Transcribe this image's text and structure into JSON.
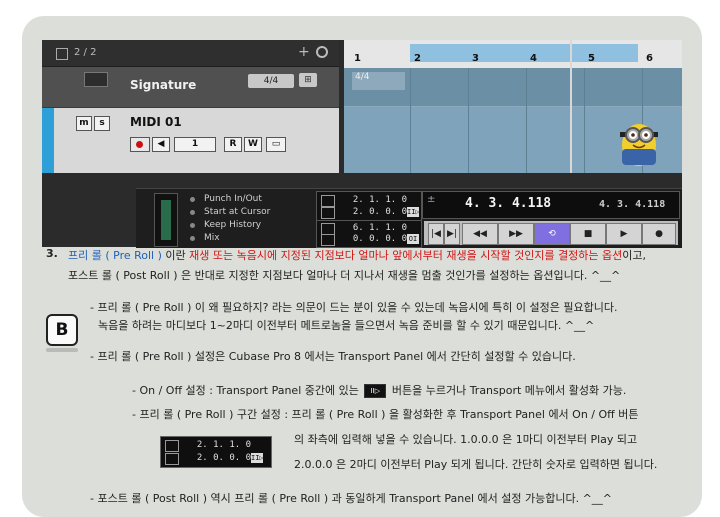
{
  "daw": {
    "track_count": "2 / 2",
    "signature_track_name": "Signature",
    "signature_value": "4/4",
    "midi_track_name": "MIDI 01",
    "midi_buttons": {
      "mute": "m",
      "solo": "s",
      "channel": "1",
      "read": "R",
      "write": "W"
    },
    "ruler_numbers": [
      "1",
      "2",
      "3",
      "4",
      "5",
      "6"
    ],
    "signature_marker": "4/4",
    "transport": {
      "options": [
        "Punch In/Out",
        "Start at Cursor",
        "Keep History",
        "Mix"
      ],
      "preroll_value": "2. 1. 1.  0",
      "postroll_value": "2. 0. 0.  0",
      "cycle_start": "6. 1. 1.  0",
      "cycle_end": "0. 0. 0.  0",
      "position_main": "4.  3.  4.118",
      "position_secondary": "4. 3. 4.118",
      "plusminus": "+\n−"
    }
  },
  "content": {
    "item_number": "3.",
    "line1_a": "프리 롤 ( Pre Roll )",
    "line1_b": " 이란 ",
    "line1_red": "재생 또는 녹음시에 지정된 지점보다 얼마나 앞에서부터 재생을 시작할 것인지를 결정하는 옵션",
    "line1_c": "이고,",
    "line2": "포스트 롤 ( Post Roll ) 은 반대로 지정한 지점보다 얼마나 더 지나서 재생을 멈출 것인가를 설정하는 옵션입니다. ^__^",
    "badge": "B",
    "bullet1_a": "- 프리 롤 ( Pre Roll ) 이 왜 필요하지? 라는 의문이 드는 분이 있을 수 있는데 녹음시에 특히 이 설정은 필요합니다.",
    "bullet1_b": "녹음을 하려는 마디보다 1~2마디 이전부터 메트로놈을 들으면서 녹음 준비를 할 수 있기 때문입니다. ^__^",
    "bullet2": "- 프리 롤 ( Pre Roll ) 설정은 Cubase Pro 8 에서는 Transport Panel 에서 간단히 설정할 수 있습니다.",
    "sub1_a": "- On / Off  설정 : Transport Panel 중간에 있는",
    "sub1_b": "버튼을 누르거나 Transport 메뉴에서 활성화 가능.",
    "sub2": "- 프리 롤 ( Pre Roll ) 구간 설정 : 프리 롤 ( Pre Roll ) 을 활성화한 후 Transport Panel 에서 On / Off 버튼",
    "sub2_c1": "의 좌측에 입력해 넣을 수 있습니다. 1.0.0.0 은 1마디 이전부터 Play 되고",
    "sub2_c2": "2.0.0.0 은 2마디 이전부터 Play 되게 됩니다. 간단히 숫자로 입력하면 됩니다.",
    "mini_pre": "2.  1.  1.  0",
    "mini_post": "2.  0.  0.  0",
    "bullet3": "- 포스트 롤 ( Post Roll ) 역시 프리 롤 ( Pre Roll ) 과 동일하게 Transport Panel 에서 설정 가능합니다. ^__^"
  }
}
